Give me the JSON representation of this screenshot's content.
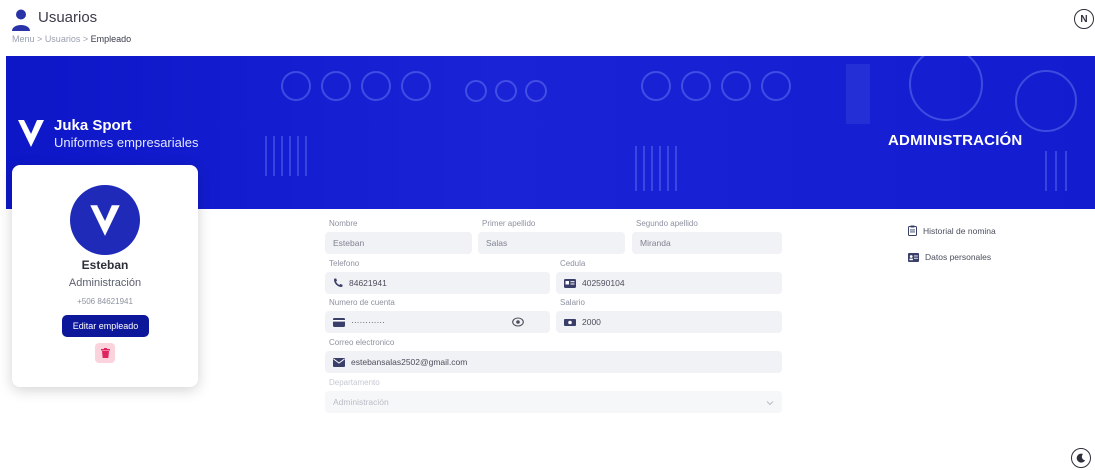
{
  "header": {
    "title": "Usuarios",
    "breadcrumb": [
      "Menu",
      "Usuarios",
      "Empleado"
    ],
    "breadcrumb_sep": ">",
    "avatar_initial": "N"
  },
  "banner": {
    "brand_name": "Juka Sport",
    "brand_subtitle": "Uniformes empresariales",
    "section_title": "ADMINISTRACIÓN",
    "color": "#131dcf"
  },
  "profile": {
    "name": "Esteban",
    "role": "Administración",
    "phone": "+506 84621941",
    "edit_label": "Editar empleado",
    "accent": "#0d1799",
    "delete_color": "#e0245e"
  },
  "form": {
    "nombre": {
      "label": "Nombre",
      "value": "Esteban"
    },
    "primer_apellido": {
      "label": "Primer apellido",
      "value": "Salas"
    },
    "segundo_apellido": {
      "label": "Segundo apellido",
      "value": "Miranda"
    },
    "telefono": {
      "label": "Telefono",
      "value": "84621941",
      "icon": "phone-icon"
    },
    "cedula": {
      "label": "Cedula",
      "value": "402590104",
      "icon": "id-card-icon"
    },
    "cuenta": {
      "label": "Numero de cuenta",
      "value": "············",
      "icon": "credit-card-icon"
    },
    "salario": {
      "label": "Salario",
      "value": "2000",
      "icon": "money-icon"
    },
    "correo": {
      "label": "Correo electronico",
      "value": "estebansalas2502@gmail.com",
      "icon": "mail-icon"
    },
    "departamento": {
      "label": "Departamento",
      "value": "Administración"
    }
  },
  "side_links": [
    {
      "label": "Historial de nomina",
      "icon": "clipboard-icon"
    },
    {
      "label": "Datos personales",
      "icon": "contact-card-icon"
    }
  ]
}
